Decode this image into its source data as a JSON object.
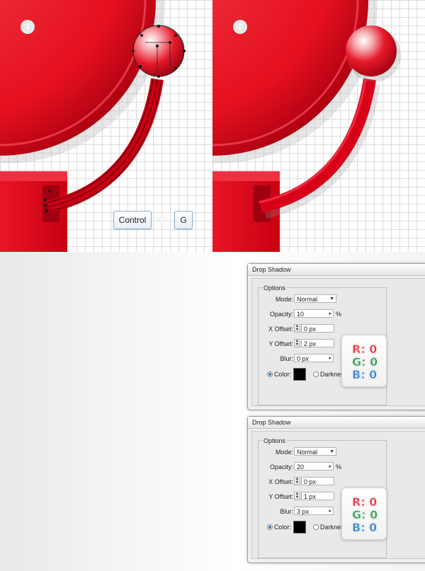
{
  "steps": {
    "step1_number": "1",
    "step2_number": "2"
  },
  "shortcut": {
    "key1": "Control",
    "plus": "+",
    "key2": "G"
  },
  "dialogs": [
    {
      "title": "Drop Shadow",
      "group_label": "Options",
      "mode_label": "Mode:",
      "mode_value": "Normal",
      "opacity_label": "Opacity:",
      "opacity_value": "10",
      "percent_sign": "%",
      "x_offset_label": "X Offset:",
      "x_offset_value": "0 px",
      "y_offset_label": "Y Offset:",
      "y_offset_value": "2 px",
      "blur_label": "Blur:",
      "blur_value": "0 px",
      "color_label": "Color:",
      "darkness_label": "Darknes",
      "rgb": {
        "r": "R: 0",
        "g": "G: 0",
        "b": "B: 0"
      }
    },
    {
      "title": "Drop Shadow",
      "group_label": "Options",
      "mode_label": "Mode:",
      "mode_value": "Normal",
      "opacity_label": "Opacity:",
      "opacity_value": "20",
      "percent_sign": "%",
      "x_offset_label": "X Offset:",
      "x_offset_value": "0 px",
      "y_offset_label": "Y Offset:",
      "y_offset_value": "1 px",
      "blur_label": "Blur:",
      "blur_value": "3 px",
      "color_label": "Color:",
      "darkness_label": "Darkness",
      "rgb": {
        "r": "R: 0",
        "g": "G: 0",
        "b": "B: 0"
      }
    }
  ],
  "colors": {
    "bell_red": "#e01020",
    "r_channel": "#e8303c",
    "g_channel": "#2aa04a",
    "b_channel": "#2f7fd0",
    "shadow_color": "#000000"
  }
}
